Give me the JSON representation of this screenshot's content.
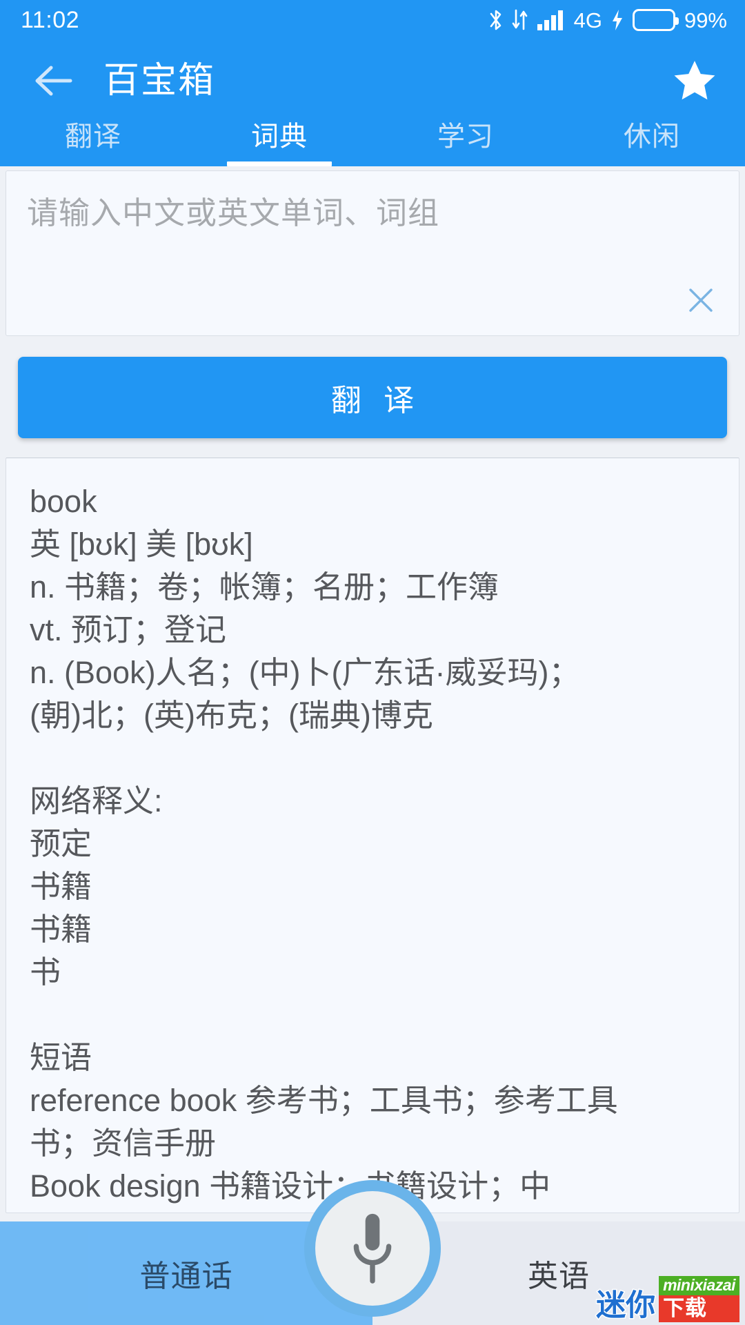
{
  "status_bar": {
    "time": "11:02",
    "network_label": "4G",
    "battery_percent": "99%",
    "icons": [
      "bluetooth-icon",
      "data-transfer-icon",
      "signal-bars-icon",
      "charging-bolt-icon",
      "battery-icon"
    ],
    "accent_color": "#2196f3",
    "battery_color": "#3ddc17"
  },
  "app_bar": {
    "title": "百宝箱",
    "back_icon": "back-arrow-icon",
    "favorite_icon": "star-icon"
  },
  "tabs": [
    {
      "label": "翻译",
      "active": false
    },
    {
      "label": "词典",
      "active": true
    },
    {
      "label": "学习",
      "active": false
    },
    {
      "label": "休闲",
      "active": false
    }
  ],
  "search": {
    "value": "",
    "placeholder": "请输入中文或英文单词、词组",
    "clear_icon": "close-icon"
  },
  "translate_button": {
    "label": "翻 译"
  },
  "result": {
    "lines": [
      "book",
      "英 [bʊk] 美 [bʊk]",
      "n. 书籍；卷；帐簿；名册；工作簿",
      "vt. 预订；登记",
      "n. (Book)人名；(中)卜(广东话·威妥玛)；",
      "(朝)北；(英)布克；(瑞典)博克",
      "",
      "网络释义:",
      "预定",
      "书籍",
      "书籍",
      "书",
      "",
      "短语",
      "reference book 参考书；工具书；参考工具",
      "书；资信手册",
      "Book design 书籍设计；书籍设计；中"
    ]
  },
  "bottom_bar": {
    "left_language": "普通话",
    "right_language": "英语",
    "mic_icon": "microphone-icon"
  },
  "watermark": {
    "char_1": "迷",
    "char_2": "你",
    "mini_text": "minixiazai",
    "download_text": "下载"
  }
}
